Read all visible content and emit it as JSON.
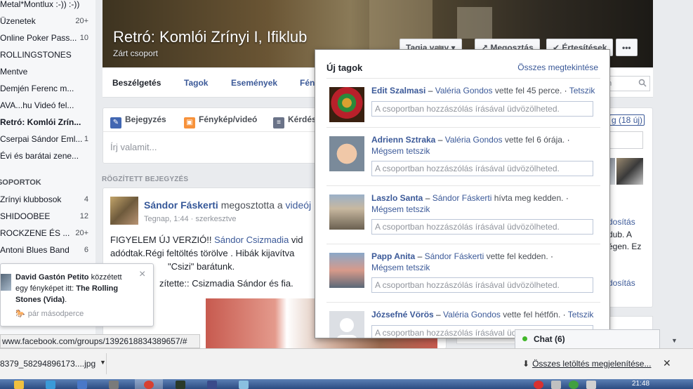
{
  "sidebar": {
    "items": [
      {
        "label": "Metal*Montlux :-)) :-))",
        "count": ""
      },
      {
        "label": "Üzenetek",
        "count": "20+"
      },
      {
        "label": "Online Poker Pass...",
        "count": "10"
      },
      {
        "label": "ROLLINGSTONES",
        "count": ""
      },
      {
        "label": "Mentve",
        "count": ""
      },
      {
        "label": "Demjén Ferenc m...",
        "count": ""
      },
      {
        "label": "AVA...hu Videó fel...",
        "count": ""
      },
      {
        "label": "Retró: Komlói Zrín...",
        "count": ""
      },
      {
        "label": "Cserpai Sándor Eml...",
        "count": "1"
      },
      {
        "label": "Évi és barátai zene...",
        "count": ""
      },
      {
        "label": "Zrínyi klubbosok",
        "count": "4"
      },
      {
        "label": "SHIDOOBEE",
        "count": "12"
      },
      {
        "label": "ROCKZENE ÉS ...",
        "count": "20+"
      },
      {
        "label": "Antoni Blues Band",
        "count": "6"
      }
    ],
    "section": "CSOPORTOK"
  },
  "group": {
    "title": "Retró: Komlói Zrínyi I, Ifiklub",
    "subtitle": "Zárt csoport",
    "buttons": {
      "member": "Tagja vagy ▾",
      "share": "↗ Megosztás",
      "notifications": "✔ Értesítések",
      "more": "•••"
    },
    "tabs": [
      "Beszélgetés",
      "Tagok",
      "Események",
      "Fén"
    ],
    "search_placeholder": "ön"
  },
  "composer": {
    "tabs": [
      "Bejegyzés",
      "Fénykép/videó",
      "Kérdés"
    ],
    "placeholder": "Írj valamit..."
  },
  "pinned_label": "RÖGZÍTETT BEJEGYZÉS",
  "post": {
    "author": "Sándor Fáskerti",
    "verb": " megosztotta a ",
    "object": "videój",
    "time": "Tegnap, 1:44",
    "edited": " · szerkesztve",
    "lines": [
      {
        "pre": "FIGYELEM ÚJ VERZIÓ!! ",
        "link": "Sándor Csizmadia",
        "post": " vid"
      },
      {
        "pre": "adódtak.Régi feltöltés törölve . Hibák kijavítva",
        "link": "",
        "post": ""
      },
      {
        "pre": "\"Csizi\" barátunk.",
        "link": "",
        "post": ""
      },
      {
        "pre": "zítette:: Csizmadia Sándor és fia.",
        "link": "",
        "post": ""
      }
    ]
  },
  "right": {
    "badge_prefix": "g ",
    "badge": "(18 új)",
    "texts": [
      "dosítás",
      "dub. A",
      "égen. Ez",
      "dosítás"
    ]
  },
  "popup": {
    "title": "Új tagok",
    "see_all": "Összes megtekintése",
    "comment_placeholder": "A csoportban hozzászólás írásával üdvözölheted.",
    "members": [
      {
        "name": "Edit Szalmasi",
        "inviter": "Valéria Gondos",
        "action": "vette fel 45 perce.",
        "like": "Tetszik",
        "wrap": false
      },
      {
        "name": "Adrienn Sztraka",
        "inviter": "Valéria Gondos",
        "action": "vette fel 6 órája.",
        "like": "Mégsem tetszik",
        "wrap": true
      },
      {
        "name": "Laszlo Santa",
        "inviter": "Sándor Fáskerti",
        "action": "hívta meg kedden.",
        "like": "Mégsem tetszik",
        "wrap": true
      },
      {
        "name": "Papp Anita",
        "inviter": "Sándor Fáskerti",
        "action": "vette fel kedden.",
        "like": "Mégsem tetszik",
        "wrap": true
      },
      {
        "name": "Józsefné Vörös",
        "inviter": "Valéria Gondos",
        "action": "vette fel hétfőn.",
        "like": "Tetszik",
        "wrap": false
      }
    ]
  },
  "toast": {
    "actor": "David Gastón Petito",
    "verb": " közzétett egy fényképet itt: ",
    "target": "The Rolling Stones (Vida)",
    "end": ".",
    "time": "pár másodperce"
  },
  "chat": {
    "label": "Chat (6)"
  },
  "status_url": "www.facebook.com/groups/1392618834389657/#",
  "download": {
    "file": "8379_58294896173....jpg",
    "show_all": "Összes letöltés megjelenítése..."
  },
  "taskbar": {
    "clock": "21:48"
  },
  "colors": {
    "fb_blue": "#3b5998",
    "link": "#365899",
    "bg": "#e9ebee"
  }
}
